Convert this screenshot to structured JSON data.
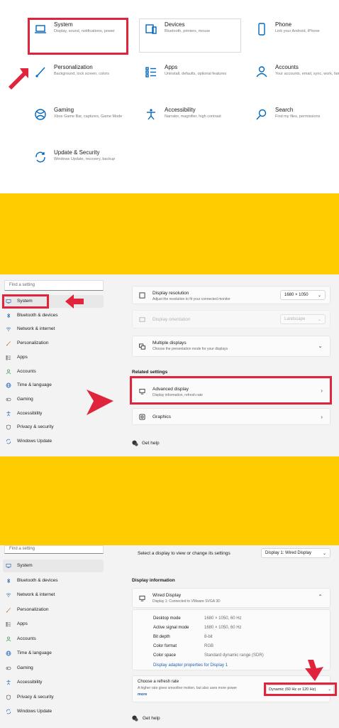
{
  "colors": {
    "accent": "#0067c0",
    "highlight_box": "#e0243c",
    "divider": "#ffcc00"
  },
  "settings_home": {
    "tiles": [
      {
        "icon": "laptop-icon",
        "title": "System",
        "subtitle": "Display, sound, notifications, power"
      },
      {
        "icon": "devices-icon",
        "title": "Devices",
        "subtitle": "Bluetooth, printers, mouse"
      },
      {
        "icon": "phone-icon",
        "title": "Phone",
        "subtitle": "Link your Android, iPhone"
      },
      {
        "icon": "brush-icon",
        "title": "Personalization",
        "subtitle": "Background, lock screen, colors"
      },
      {
        "icon": "apps-icon",
        "title": "Apps",
        "subtitle": "Uninstall, defaults, optional features"
      },
      {
        "icon": "person-icon",
        "title": "Accounts",
        "subtitle": "Your accounts, email, sync, work, family"
      },
      {
        "icon": "xbox-icon",
        "title": "Gaming",
        "subtitle": "Xbox Game Bar, captures, Game Mode"
      },
      {
        "icon": "accessibility-icon",
        "title": "Accessibility",
        "subtitle": "Narrator, magnifier, high contrast"
      },
      {
        "icon": "search-icon",
        "title": "Search",
        "subtitle": "Find my files, permissions"
      },
      {
        "icon": "sync-icon",
        "title": "Update & Security",
        "subtitle": "Windows Update, recovery, backup"
      }
    ]
  },
  "display_page": {
    "search_placeholder": "Find a setting",
    "nav": [
      {
        "icon": "monitor-icon",
        "label": "System"
      },
      {
        "icon": "bluetooth-icon",
        "label": "Bluetooth & devices"
      },
      {
        "icon": "wifi-icon",
        "label": "Network & internet"
      },
      {
        "icon": "brush-icon",
        "label": "Personalization"
      },
      {
        "icon": "apps-icon",
        "label": "Apps"
      },
      {
        "icon": "person-icon",
        "label": "Accounts"
      },
      {
        "icon": "globe-icon",
        "label": "Time & language"
      },
      {
        "icon": "gamepad-icon",
        "label": "Gaming"
      },
      {
        "icon": "accessibility-icon",
        "label": "Accessibility"
      },
      {
        "icon": "shield-icon",
        "label": "Privacy & security"
      },
      {
        "icon": "update-icon",
        "label": "Windows Update"
      }
    ],
    "resolution": {
      "title": "Display resolution",
      "subtitle": "Adjust the resolution to fit your connected monitor",
      "value": "1680 × 1050"
    },
    "orientation": {
      "title": "Display orientation",
      "value": "Landscape"
    },
    "multiple": {
      "title": "Multiple displays",
      "subtitle": "Choose the presentation mode for your displays"
    },
    "related_heading": "Related settings",
    "advanced": {
      "title": "Advanced display",
      "subtitle": "Display information, refresh rate"
    },
    "graphics": {
      "title": "Graphics"
    },
    "get_help": "Get help"
  },
  "advanced_page": {
    "search_placeholder": "Find a setting",
    "select_label": "Select a display to view or change its settings",
    "select_value": "Display 1: Wired Display",
    "info_heading": "Display information",
    "display_name": "Wired Display",
    "display_sub": "Display 1: Connected to VMware SVGA 3D",
    "info": [
      {
        "k": "Desktop mode",
        "v": "1680 × 1050, 60 Hz"
      },
      {
        "k": "Active signal mode",
        "v": "1680 × 1050, 60 Hz"
      },
      {
        "k": "Bit depth",
        "v": "8-bit"
      },
      {
        "k": "Color format",
        "v": "RGB"
      },
      {
        "k": "Color space",
        "v": "Standard dynamic range (SDR)"
      }
    ],
    "adapter_link": "Display adapter properties for Display 1",
    "refresh_title": "Choose a refresh rate",
    "refresh_sub": "A higher rate gives smoother motion, but also uses more power",
    "refresh_more": "more",
    "refresh_value": "Dynamic (60 Hz or 120 Hz)",
    "get_help": "Get help"
  }
}
